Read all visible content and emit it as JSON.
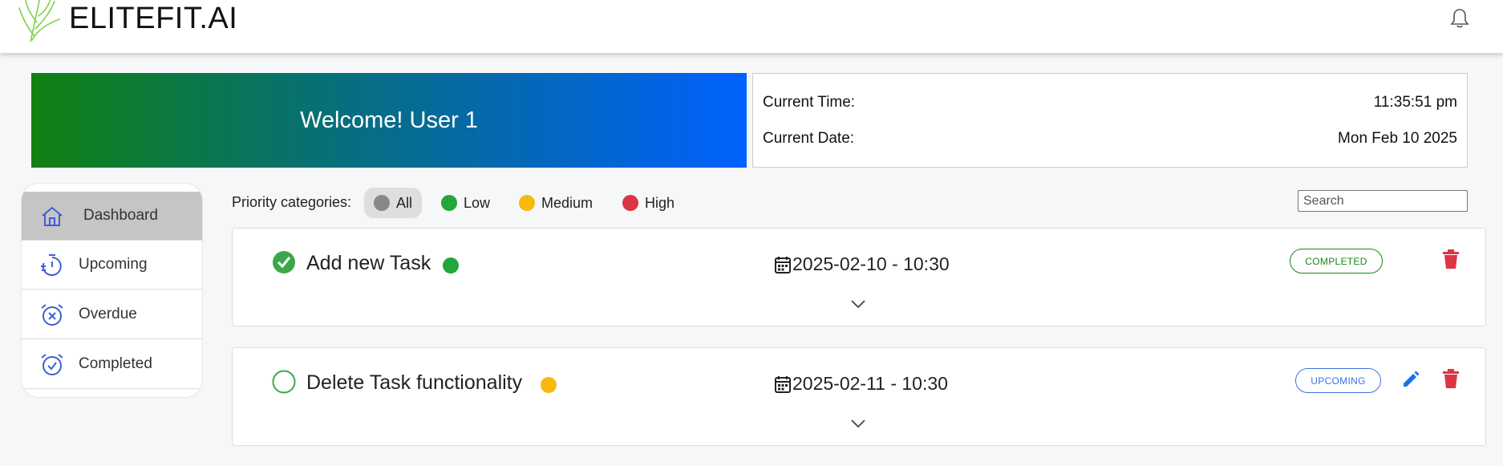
{
  "header": {
    "brand": "ELITEFIT.AI",
    "logo_icon": "palm-leaf-logo-icon",
    "notification_icon": "bell-icon"
  },
  "welcome": {
    "text": "Welcome! User 1"
  },
  "clock": {
    "time_label": "Current Time:",
    "time_value": "11:35:51 pm",
    "date_label": "Current Date:",
    "date_value": "Mon Feb 10 2025"
  },
  "sidebar": {
    "items": [
      {
        "label": "Dashboard",
        "icon": "home-icon",
        "active": true
      },
      {
        "label": "Upcoming",
        "icon": "timer-icon",
        "active": false
      },
      {
        "label": "Overdue",
        "icon": "alarm-off-icon",
        "active": false
      },
      {
        "label": "Completed",
        "icon": "alarm-check-icon",
        "active": false
      }
    ]
  },
  "filters": {
    "label": "Priority categories:",
    "options": [
      {
        "label": "All",
        "color": "#888888"
      },
      {
        "label": "Low",
        "color": "#22a73a"
      },
      {
        "label": "Medium",
        "color": "#f7b90d"
      },
      {
        "label": "High",
        "color": "#dc3546"
      }
    ]
  },
  "search": {
    "placeholder": "Search"
  },
  "tasks": [
    {
      "title": "Add new Task",
      "priority_color": "#22a73a",
      "datetime": "2025-02-10 - 10:30",
      "status": "COMPLETED",
      "completed": true
    },
    {
      "title": "Delete Task functionality",
      "priority_color": "#f7b90d",
      "datetime": "2025-02-11 - 10:30",
      "status": "UPCOMING",
      "completed": false
    }
  ],
  "colors": {
    "accent_blue": "#0061ff",
    "accent_green": "#118011",
    "delete_red": "#dc3546",
    "edit_blue": "#1a73e8"
  }
}
